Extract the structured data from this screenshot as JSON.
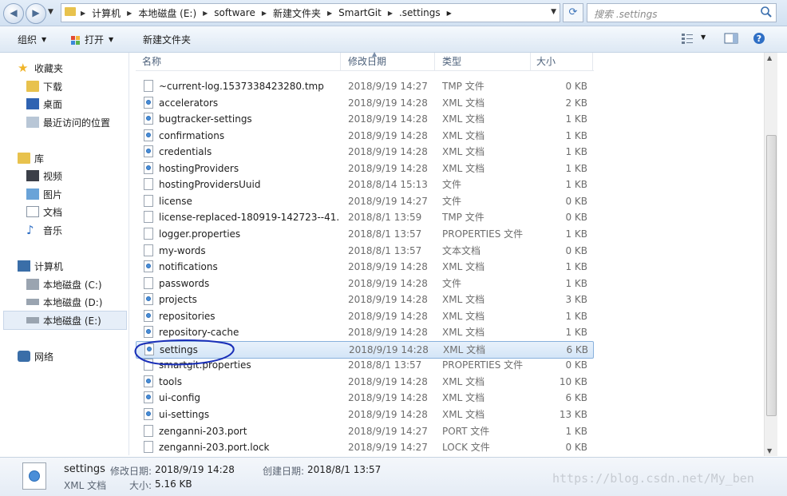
{
  "address": {
    "crumbs": [
      "计算机",
      "本地磁盘 (E:)",
      "software",
      "新建文件夹",
      "SmartGit",
      ".settings"
    ],
    "search_placeholder": "搜索 .settings"
  },
  "toolbar": {
    "organize": "组织",
    "open": "打开",
    "new_folder": "新建文件夹"
  },
  "sidebar": {
    "favorites": "收藏夹",
    "fav_items": [
      "下载",
      "桌面",
      "最近访问的位置"
    ],
    "libraries": "库",
    "lib_items": [
      "视频",
      "图片",
      "文档",
      "音乐"
    ],
    "computer": "计算机",
    "drives": [
      "本地磁盘 (C:)",
      "本地磁盘 (D:)",
      "本地磁盘 (E:)"
    ],
    "network": "网络"
  },
  "columns": {
    "name": "名称",
    "date": "修改日期",
    "type": "类型",
    "size": "大小"
  },
  "files": [
    {
      "name": "~current-log.1537338423280.tmp",
      "date": "2018/9/19 14:27",
      "type": "TMP 文件",
      "size": "0 KB",
      "xml": false
    },
    {
      "name": "accelerators",
      "date": "2018/9/19 14:28",
      "type": "XML 文档",
      "size": "2 KB",
      "xml": true
    },
    {
      "name": "bugtracker-settings",
      "date": "2018/9/19 14:28",
      "type": "XML 文档",
      "size": "1 KB",
      "xml": true
    },
    {
      "name": "confirmations",
      "date": "2018/9/19 14:28",
      "type": "XML 文档",
      "size": "1 KB",
      "xml": true
    },
    {
      "name": "credentials",
      "date": "2018/9/19 14:28",
      "type": "XML 文档",
      "size": "1 KB",
      "xml": true
    },
    {
      "name": "hostingProviders",
      "date": "2018/9/19 14:28",
      "type": "XML 文档",
      "size": "1 KB",
      "xml": true
    },
    {
      "name": "hostingProvidersUuid",
      "date": "2018/8/14 15:13",
      "type": "文件",
      "size": "1 KB",
      "xml": false
    },
    {
      "name": "license",
      "date": "2018/9/19 14:27",
      "type": "文件",
      "size": "0 KB",
      "xml": false
    },
    {
      "name": "license-replaced-180919-142723--41...",
      "date": "2018/8/1 13:59",
      "type": "TMP 文件",
      "size": "0 KB",
      "xml": false
    },
    {
      "name": "logger.properties",
      "date": "2018/8/1 13:57",
      "type": "PROPERTIES 文件",
      "size": "1 KB",
      "xml": false
    },
    {
      "name": "my-words",
      "date": "2018/8/1 13:57",
      "type": "文本文档",
      "size": "0 KB",
      "xml": false
    },
    {
      "name": "notifications",
      "date": "2018/9/19 14:28",
      "type": "XML 文档",
      "size": "1 KB",
      "xml": true
    },
    {
      "name": "passwords",
      "date": "2018/9/19 14:28",
      "type": "文件",
      "size": "1 KB",
      "xml": false
    },
    {
      "name": "projects",
      "date": "2018/9/19 14:28",
      "type": "XML 文档",
      "size": "3 KB",
      "xml": true
    },
    {
      "name": "repositories",
      "date": "2018/9/19 14:28",
      "type": "XML 文档",
      "size": "1 KB",
      "xml": true
    },
    {
      "name": "repository-cache",
      "date": "2018/9/19 14:28",
      "type": "XML 文档",
      "size": "1 KB",
      "xml": true
    },
    {
      "name": "settings",
      "date": "2018/9/19 14:28",
      "type": "XML 文档",
      "size": "6 KB",
      "xml": true,
      "selected": true
    },
    {
      "name": "smartgit.properties",
      "date": "2018/8/1 13:57",
      "type": "PROPERTIES 文件",
      "size": "0 KB",
      "xml": false
    },
    {
      "name": "tools",
      "date": "2018/9/19 14:28",
      "type": "XML 文档",
      "size": "10 KB",
      "xml": true
    },
    {
      "name": "ui-config",
      "date": "2018/9/19 14:28",
      "type": "XML 文档",
      "size": "6 KB",
      "xml": true
    },
    {
      "name": "ui-settings",
      "date": "2018/9/19 14:28",
      "type": "XML 文档",
      "size": "13 KB",
      "xml": true
    },
    {
      "name": "zenganni-203.port",
      "date": "2018/9/19 14:27",
      "type": "PORT 文件",
      "size": "1 KB",
      "xml": false
    },
    {
      "name": "zenganni-203.port.lock",
      "date": "2018/9/19 14:27",
      "type": "LOCK 文件",
      "size": "0 KB",
      "xml": false
    }
  ],
  "details": {
    "name": "settings",
    "type": "XML 文档",
    "modified_label": "修改日期:",
    "modified": "2018/9/19 14:28",
    "created_label": "创建日期:",
    "created": "2018/8/1 13:57",
    "size_label": "大小:",
    "size": "5.16 KB"
  },
  "watermark": "https://blog.csdn.net/My_ben"
}
